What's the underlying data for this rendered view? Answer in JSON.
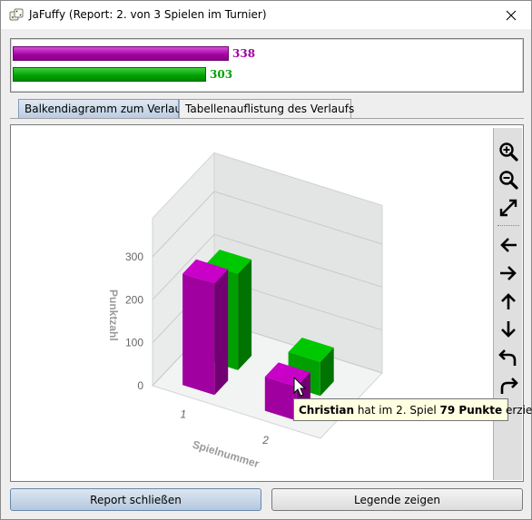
{
  "window": {
    "title": "JaFuffy (Report: 2. von 3 Spielen im Turnier)"
  },
  "scores": [
    {
      "value": "338",
      "color": "#a000a0",
      "fraction": 0.441
    },
    {
      "value": "303",
      "color": "#00a000",
      "fraction": 0.395
    }
  ],
  "tabs": [
    {
      "label": "Balkendiagramm zum Verlauf",
      "active": true
    },
    {
      "label": "Tabellenauflistung des Verlaufs",
      "active": false
    }
  ],
  "chart_data": {
    "type": "bar",
    "categories": [
      "1",
      "2"
    ],
    "xlabel": "Spielnummer",
    "ylabel": "Punktzahl",
    "ylim": [
      0,
      300
    ],
    "yticks": [
      "0",
      "100",
      "200",
      "300"
    ],
    "series": [
      {
        "color": "#a000a0",
        "values": [
          259,
          79
        ]
      },
      {
        "color": "#00a000",
        "values": [
          224,
          79
        ]
      }
    ]
  },
  "toolbar": {
    "items": [
      "zoom-in-icon",
      "zoom-out-icon",
      "fit-icon",
      "arrow-left-icon",
      "arrow-right-icon",
      "arrow-up-icon",
      "arrow-down-icon",
      "undo-icon",
      "redo-icon"
    ]
  },
  "tooltip": {
    "name": "Christian",
    "mid1": " hat im 2. Spiel ",
    "points": "79 Punkte",
    "end": " erzielt."
  },
  "buttons": {
    "close": "Report schließen",
    "legend": "Legende zeigen"
  }
}
